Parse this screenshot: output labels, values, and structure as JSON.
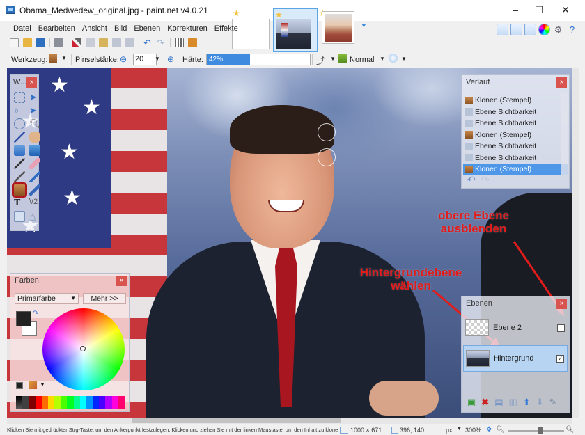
{
  "window": {
    "title": "Obama_Medwedew_original.jpg - paint.net v4.0.21",
    "minimize": "–",
    "maximize": "☐",
    "close": "✕"
  },
  "menu": [
    "Datei",
    "Bearbeiten",
    "Ansicht",
    "Bild",
    "Ebenen",
    "Korrekturen",
    "Effekte"
  ],
  "options": {
    "tool_label": "Werkzeug:",
    "brush_label": "Pinselstärke:",
    "brush_size": "20",
    "hardness_label": "Härte:",
    "hardness_value": "42%",
    "hardness_fraction": 0.42,
    "blend_mode": "Normal"
  },
  "tools_panel": {
    "title": "W..."
  },
  "history_panel": {
    "title": "Verlauf",
    "items": [
      "Klonen (Stempel)",
      "Ebene Sichtbarkeit",
      "Ebene Sichtbarkeit",
      "Klonen (Stempel)",
      "Ebene Sichtbarkeit",
      "Ebene Sichtbarkeit",
      "Klonen (Stempel)"
    ],
    "selected_index": 6
  },
  "layers_panel": {
    "title": "Ebenen",
    "layers": [
      {
        "name": "Ebene 2",
        "visible": false
      },
      {
        "name": "Hintergrund",
        "visible": true
      }
    ]
  },
  "colors_panel": {
    "title": "Farben",
    "primary_select": "Primärfarbe",
    "more_button": "Mehr >>"
  },
  "annotations": {
    "hide_top_layer": "obere Ebene\nausblenden",
    "choose_background": "Hintergrundebene\nwählen"
  },
  "status": {
    "hint": "Klicken Sie mit gedrückter Strg-Taste, um den Ankerpunkt festzulegen. Klicken und ziehen Sie mit der linken Maustaste, um den Inhalt zu klonen.",
    "image_size": "1000 × 671",
    "cursor_pos": "396, 140",
    "unit": "px",
    "zoom": "300%"
  },
  "colors": {
    "accent": "#4d96e8",
    "annotation": "#e21b1b",
    "close": "#d9534f"
  }
}
